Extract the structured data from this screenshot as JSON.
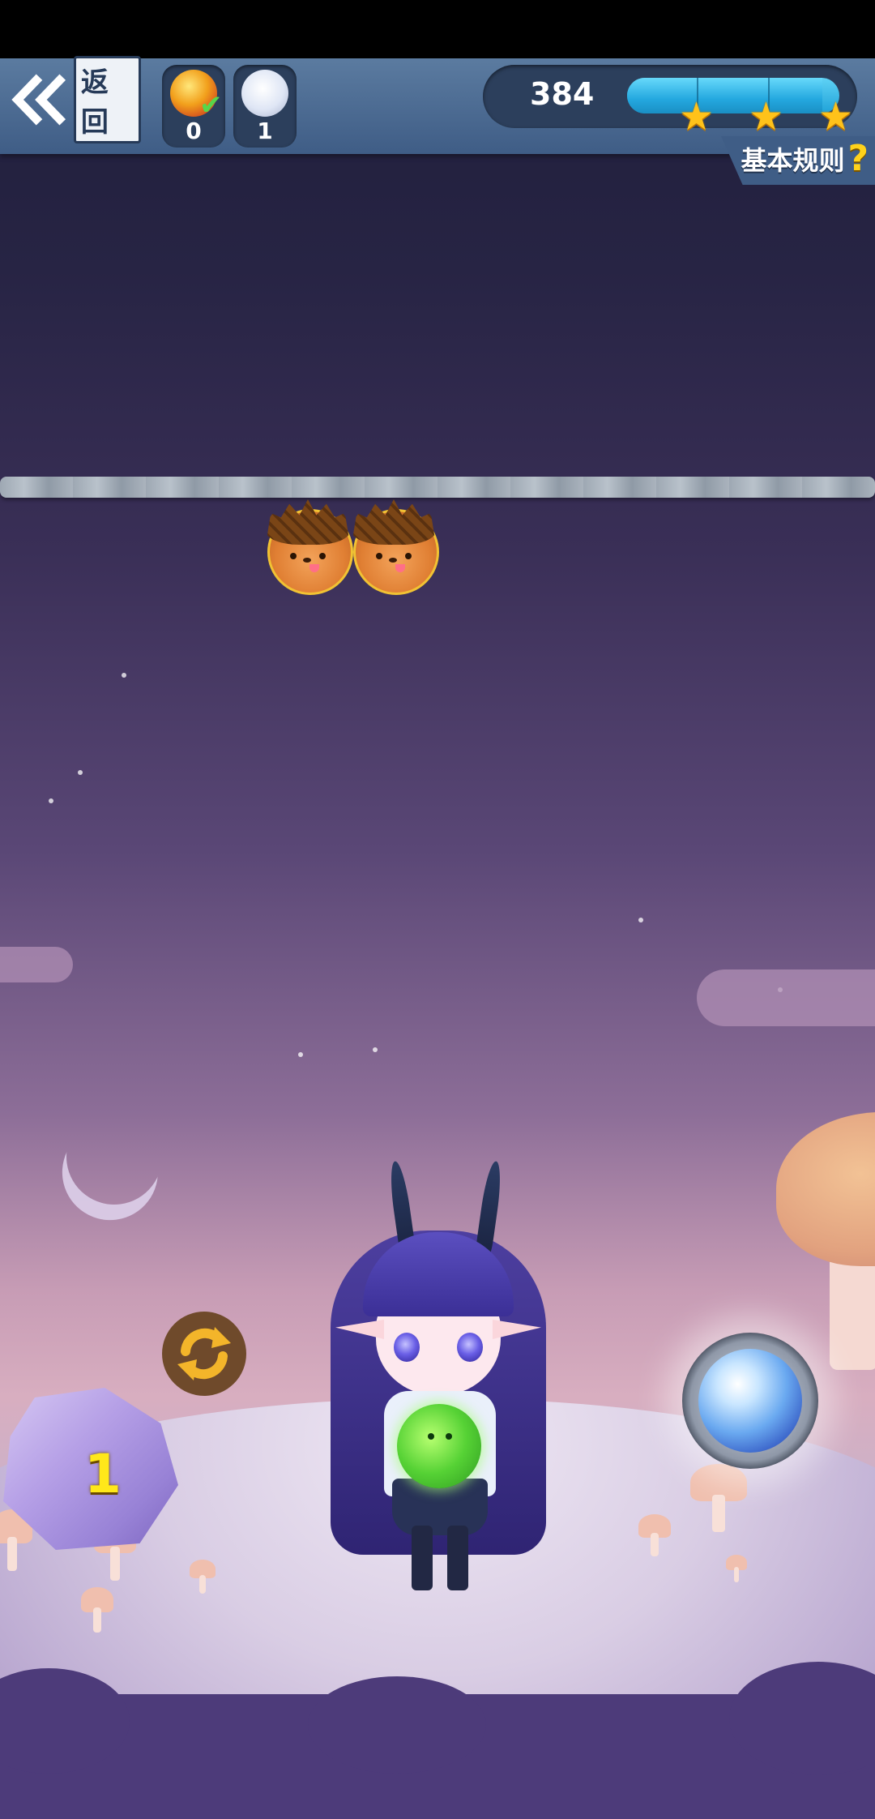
{
  "topbar": {
    "back_label": "返回",
    "slots": [
      {
        "icon": "gold-ball-icon",
        "count": "0"
      },
      {
        "icon": "white-bunny-icon",
        "count": "1"
      }
    ],
    "score": "384",
    "progress_fraction": 0.92,
    "stars_earned": 3,
    "rules_label": "基本规则",
    "rules_icon": "?"
  },
  "board": {
    "bubbles": [
      {
        "type": "acorn"
      },
      {
        "type": "acorn"
      }
    ]
  },
  "shooter": {
    "ammo_count": "1",
    "current_bubble": "green-dino-egg",
    "next_bubble": "glass-orb"
  },
  "colors": {
    "topbar": "#3f5d86",
    "progress": "#24a8df",
    "star": "#ffc21a",
    "ammo_text": "#ffe81a"
  }
}
